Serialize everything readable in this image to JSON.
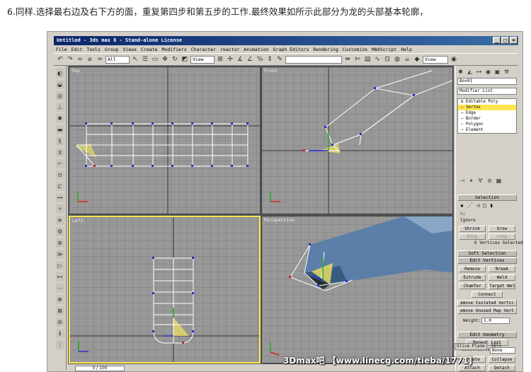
{
  "caption": "6.同样.选择最右边及右下方的面，重复第四步和第五步的工作.最终效果如所示此部分为龙的头部基本轮廓，",
  "window": {
    "title": "Untitled - 3ds max 6 - Stand-alone License",
    "btn_min": "_",
    "btn_max": "□",
    "btn_close": "×"
  },
  "menu": [
    "File",
    "Edit",
    "Tools",
    "Group",
    "Views",
    "Create",
    "Modifiers",
    "Character",
    "reactor",
    "Animation",
    "Graph Editors",
    "Rendering",
    "Customize",
    "MAXScript",
    "Help"
  ],
  "toolbar": {
    "filter_value": "All",
    "refcoord_value": "View",
    "named_sel_value": "",
    "view_combo": "View"
  },
  "viewports": {
    "top": "Top",
    "front": "Front",
    "left": "Left",
    "perspective": "Perspective"
  },
  "timebar": {
    "value": "0 / 100"
  },
  "panel": {
    "object_name": "Box01",
    "modifier_list": "Modifier List",
    "stack": [
      {
        "label": "⊟ Editable Poly"
      },
      {
        "label": "— Vertex"
      },
      {
        "label": "— Edge"
      },
      {
        "label": "— Border"
      },
      {
        "label": "— Polygon"
      },
      {
        "label": "— Element"
      }
    ],
    "selection_title": "Selection",
    "by_label": "By",
    "ignore_label": "Ignore",
    "shrink": "Shrink",
    "grow": "Grow",
    "ring": "Ring",
    "loop": "Loop",
    "selected_status": "6 Vertices Selected",
    "soft_selection": "Soft Selection",
    "edit_vertices": "Edit Vertices",
    "remove": "Remove",
    "break_label": "Break",
    "extrude": "Extrude",
    "weld": "Weld",
    "chamfer": "Chamfer",
    "target_weld": "Target Weld",
    "connect": "Connect",
    "remove_isolated": "emove Isolated Vertic",
    "remove_unused": "emove Unused Map Vert",
    "weight_label": "Weight:",
    "weight_value": "1.0",
    "edit_geometry": "Edit Geometry",
    "repeat_last": "Repeat Last",
    "constraints_label": "Constraints:",
    "constraints_value": "None",
    "create": "Create",
    "collapse": "Collapse",
    "attach": "Attach",
    "detach": "Detach",
    "slice_plane": "Slice Plane",
    "split": "Spli"
  },
  "watermark": "3Dmax吧 【www.linecg.com/tieba/1771】",
  "colors": {
    "selection": "#ffe650",
    "wire": "#ffffff",
    "vertex": "#2a2ad0",
    "viewport_bg": "#989898"
  }
}
